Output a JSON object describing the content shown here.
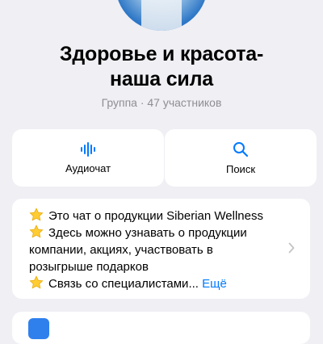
{
  "group": {
    "title_line1": "Здоровье и красота-",
    "title_line2": "наша сила",
    "subtitle": "Группа · 47 участников"
  },
  "actions": {
    "audio_label": "Аудиочат",
    "search_label": "Поиск"
  },
  "description": {
    "line1": "Это чат о продукции Siberian Wellness",
    "line2": "Здесь можно узнавать о продукции",
    "line3": "компании, акциях, участвовать в",
    "line4": "розыгрыше подарков",
    "line5": "Связь со специалистами...",
    "more_link": "Ещё"
  },
  "icons": {
    "audio": "waveform-icon",
    "search": "magnifier-icon",
    "star": "star-emoji-icon",
    "chevron": "chevron-right-icon",
    "bottom": "app-icon"
  },
  "colors": {
    "background": "#efeff4",
    "card": "#ffffff",
    "accent": "#007aff",
    "secondary_text": "#8e8e93"
  }
}
